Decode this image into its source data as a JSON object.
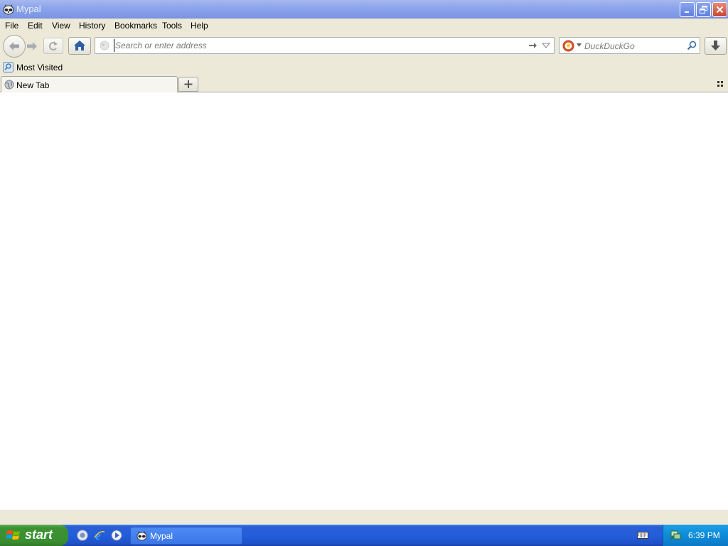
{
  "window": {
    "title": "Mypal",
    "buttons": {
      "minimize": "minimize-icon",
      "restore": "restore-icon",
      "close": "close-icon"
    }
  },
  "menubar": {
    "items": [
      {
        "label": "File"
      },
      {
        "label": "Edit"
      },
      {
        "label": "View"
      },
      {
        "label": "History"
      },
      {
        "label": "Bookmarks"
      },
      {
        "label": "Tools"
      },
      {
        "label": "Help"
      }
    ]
  },
  "navbar": {
    "back_icon": "back-arrow-icon",
    "forward_icon": "forward-arrow-icon",
    "reload_icon": "reload-icon",
    "home_icon": "home-icon",
    "address_placeholder": "Search or enter address",
    "address_value": "",
    "search_placeholder": "DuckDuckGo",
    "search_value": "",
    "download_icon": "download-icon"
  },
  "bookmarks": {
    "items": [
      {
        "label": "Most Visited"
      }
    ]
  },
  "tabs": {
    "items": [
      {
        "label": "New Tab",
        "active": true
      }
    ],
    "new_tab_icon": "plus-icon"
  },
  "taskbar": {
    "start_label": "start",
    "quick_launch": [
      "browser-icon",
      "internet-explorer-icon",
      "media-player-icon"
    ],
    "tasks": [
      {
        "label": "Mypal"
      }
    ],
    "clock": "6:39 PM"
  },
  "colors": {
    "titlebar": "#8ea6ec",
    "chrome": "#ece9d8",
    "taskbar": "#245edb",
    "start": "#3c9233",
    "tray": "#0f8bd8"
  }
}
